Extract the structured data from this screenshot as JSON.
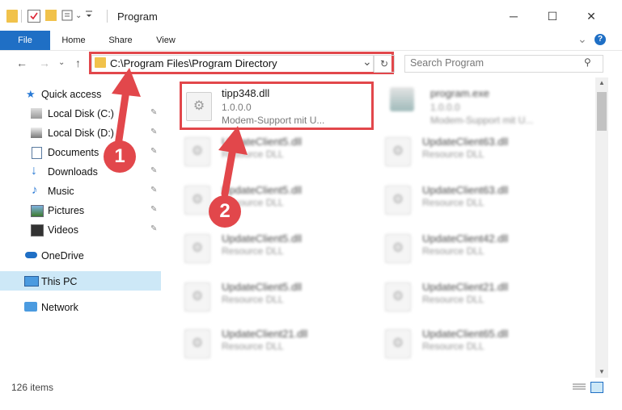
{
  "window": {
    "title": "Program",
    "minimize_glyph": "─",
    "maximize_glyph": "☐",
    "close_glyph": "✕"
  },
  "ribbon": {
    "tabs": [
      "File",
      "Home",
      "Share",
      "View"
    ],
    "chevron_glyph": "⌄",
    "help_glyph": "?"
  },
  "address_bar": {
    "path": "C:\\Program Files\\Program Directory",
    "dropdown_glyph": "⌄",
    "refresh_glyph": "↻"
  },
  "search": {
    "placeholder": "Search Program",
    "icon": "search-icon",
    "glyph": "⚲"
  },
  "nav": {
    "back_glyph": "←",
    "forward_glyph": "→",
    "recent_glyph": "⌄",
    "up_glyph": "↑",
    "pin_glyph": "✎",
    "items": [
      {
        "label": "Quick access"
      },
      {
        "label": "Local Disk (C:)"
      },
      {
        "label": "Local Disk (D:)"
      },
      {
        "label": "Documents"
      },
      {
        "label": "Downloads"
      },
      {
        "label": "Music"
      },
      {
        "label": "Pictures"
      },
      {
        "label": "Videos"
      },
      {
        "label": "OneDrive"
      },
      {
        "label": "This PC"
      },
      {
        "label": "Network"
      }
    ]
  },
  "files": {
    "highlighted": {
      "name": "tipp348.dll",
      "version": "1.0.0.0",
      "description": "Modem-Support mit U..."
    },
    "program": {
      "name": "program.exe",
      "version": "1.0.0.0",
      "description": "Modem-Support mit U..."
    },
    "left_column": [
      {
        "name": "UpdateClient5.dll",
        "type": "Resource DLL"
      },
      {
        "name": "UpdateClient5.dll",
        "type": "Resource DLL"
      },
      {
        "name": "UpdateClient5.dll",
        "type": "Resource DLL"
      },
      {
        "name": "UpdateClient5.dll",
        "type": "Resource DLL"
      },
      {
        "name": "UpdateClient21.dll",
        "type": "Resource DLL"
      }
    ],
    "right_column": [
      {
        "name": "UpdateClient63.dll",
        "type": "Resource DLL"
      },
      {
        "name": "UpdateClient63.dll",
        "type": "Resource DLL"
      },
      {
        "name": "UpdateClient42.dll",
        "type": "Resource DLL"
      },
      {
        "name": "UpdateClient21.dll",
        "type": "Resource DLL"
      },
      {
        "name": "UpdateClient65.dll",
        "type": "Resource DLL"
      }
    ]
  },
  "status": {
    "item_count": "126 items"
  },
  "callouts": {
    "one": "1",
    "two": "2"
  },
  "colors": {
    "accent": "#1f6fc5",
    "highlight_red": "#e2474b",
    "selected_nav": "#cde8f7"
  }
}
